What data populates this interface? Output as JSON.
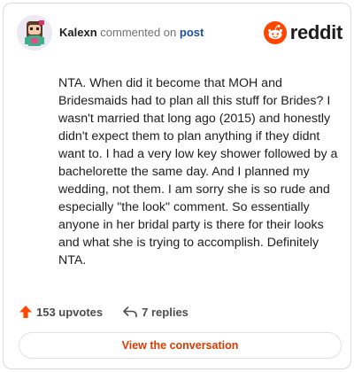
{
  "header": {
    "username": "Kalexn",
    "action_text": "commented on",
    "post_link": "post",
    "brand_name": "reddit"
  },
  "comment": {
    "body": "NTA. When did it become that MOH and Bridesmaids had to plan all this stuff for Brides? I wasn't married that long ago (2015) and honestly didn't expect them to plan anything if they didnt want to. I had a very low key shower followed by a bachelorette the same day. And I planned my wedding, not them. I am sorry she is so rude and especially \"the look\" comment. So essentially anyone in her bridal party is there for their looks and what she is trying to accomplish. Definitely NTA."
  },
  "stats": {
    "upvotes_label": "153 upvotes",
    "replies_label": "7 replies"
  },
  "cta": {
    "label": "View the conversation"
  },
  "colors": {
    "brand_orange": "#ff4500",
    "link_blue": "#1d4f9e",
    "cta_orange": "#d93a00",
    "upvote_orange": "#ff4500"
  },
  "icons": {
    "avatar": "snoo-avatar",
    "brand": "reddit-logo-icon",
    "upvote": "upvote-arrow-icon",
    "reply": "reply-arrow-icon"
  }
}
